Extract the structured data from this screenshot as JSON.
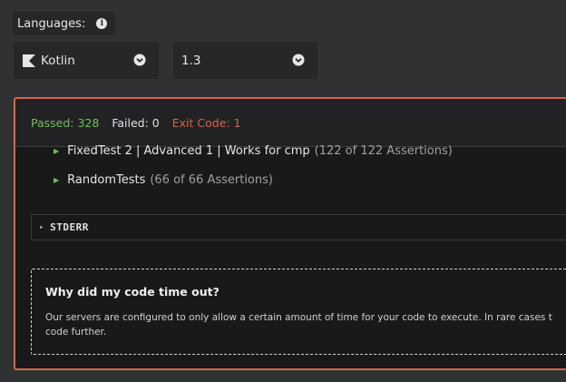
{
  "languages": {
    "label": "Languages:",
    "info_icon": "i"
  },
  "language_select": {
    "value": "Kotlin",
    "icon": "kotlin-logo-icon"
  },
  "version_select": {
    "value": "1.3"
  },
  "results": {
    "passed": "Passed: 328",
    "failed": "Failed: 0",
    "exit_code": "Exit Code: 1",
    "tests": [
      {
        "name": "FixedTest 2 | Advanced 1 | Works for cmp",
        "count": "(122 of 122 Assertions)"
      },
      {
        "name": "RandomTests",
        "count": "(66 of 66 Assertions)"
      }
    ],
    "stderr_label": "STDERR",
    "timeout": {
      "title": "Why did my code time out?",
      "line1": "Our servers are configured to only allow a certain amount of time for your code to execute. In rare cases t",
      "line2": "code further."
    }
  },
  "colors": {
    "passed": "#6fbf5a",
    "exit_code": "#d4654a",
    "panel_border": "#d4654a"
  }
}
